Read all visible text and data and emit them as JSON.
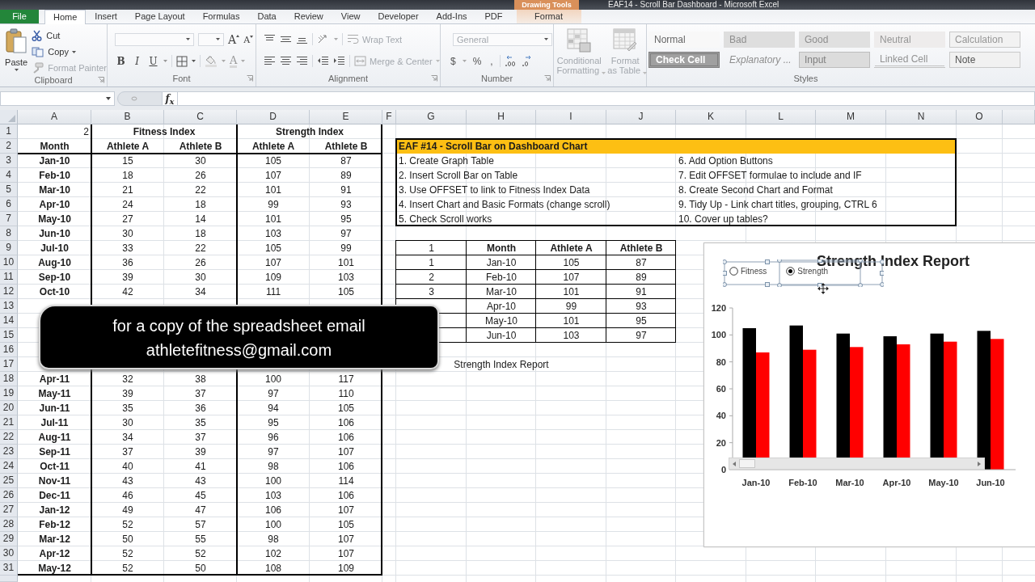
{
  "window": {
    "title": "EAF14 - Scroll Bar Dashboard - Microsoft Excel"
  },
  "contextual_group": {
    "label": "Drawing Tools"
  },
  "ribbon_tabs": [
    {
      "label": "File",
      "kind": "file",
      "selected": false
    },
    {
      "label": "Home",
      "kind": "standard",
      "selected": true
    },
    {
      "label": "Insert",
      "kind": "standard",
      "selected": false
    },
    {
      "label": "Page Layout",
      "kind": "standard",
      "selected": false
    },
    {
      "label": "Formulas",
      "kind": "standard",
      "selected": false
    },
    {
      "label": "Data",
      "kind": "standard",
      "selected": false
    },
    {
      "label": "Review",
      "kind": "standard",
      "selected": false
    },
    {
      "label": "View",
      "kind": "standard",
      "selected": false
    },
    {
      "label": "Developer",
      "kind": "standard",
      "selected": false
    },
    {
      "label": "Add-Ins",
      "kind": "standard",
      "selected": false
    },
    {
      "label": "PDF",
      "kind": "standard",
      "selected": false
    },
    {
      "label": "Format",
      "kind": "contextual",
      "selected": false
    }
  ],
  "ribbon": {
    "clipboard": {
      "label": "Clipboard",
      "paste": "Paste",
      "items": [
        {
          "kind": "cut",
          "label": "Cut",
          "dropdown": false,
          "disabled": false
        },
        {
          "kind": "copy",
          "label": "Copy",
          "dropdown": true,
          "disabled": false
        },
        {
          "kind": "painter",
          "label": "Format Painter",
          "dropdown": false,
          "disabled": true
        }
      ]
    },
    "font": {
      "label": "Font",
      "size_buttons": [
        {
          "kind": "grow",
          "glyph": "A"
        },
        {
          "kind": "shrink",
          "glyph": "A"
        }
      ],
      "style_buttons": [
        {
          "kind": "bold",
          "glyph": "B"
        },
        {
          "kind": "italic",
          "glyph": "I"
        },
        {
          "kind": "underline",
          "glyph": "U"
        }
      ],
      "font_color_glyph": "A"
    },
    "alignment": {
      "label": "Alignment",
      "wrap": {
        "label": "Wrap Text",
        "disabled": true
      },
      "merge": {
        "label": "Merge & Center",
        "disabled": true
      }
    },
    "number": {
      "label": "Number",
      "format": {
        "value": "General",
        "disabled": true
      },
      "symbols": [
        "$",
        "%",
        ","
      ]
    },
    "table_tools": [
      {
        "kind": "conditional",
        "label": "Conditional Formatting",
        "disabled": true
      },
      {
        "kind": "table",
        "label": "Format as Table",
        "disabled": true
      }
    ],
    "styles": {
      "label": "Styles",
      "items": [
        {
          "label": "Normal",
          "kind": "normal"
        },
        {
          "label": "Bad",
          "kind": "bad"
        },
        {
          "label": "Good",
          "kind": "good"
        },
        {
          "label": "Neutral",
          "kind": "neutral"
        },
        {
          "label": "Calculation",
          "kind": "calculation"
        },
        {
          "label": "Check Cell",
          "kind": "check"
        },
        {
          "label": "Explanatory ...",
          "kind": "explanatory"
        },
        {
          "label": "Input",
          "kind": "input"
        },
        {
          "label": "Linked Cell",
          "kind": "linked"
        },
        {
          "label": "Note",
          "kind": "note"
        }
      ]
    }
  },
  "formula_bar": {
    "function_label": "f$_{x}$"
  },
  "sheet": {
    "column_headers": [
      "A",
      "B",
      "C",
      "D",
      "E",
      "F",
      "G",
      "H",
      "I",
      "J",
      "K",
      "L",
      "M",
      "N",
      "O"
    ],
    "rows": [
      {
        "number": "1",
        "fitness_title": {
          "corner": "2",
          "groups": [
            "Fitness Index",
            "Strength Index"
          ]
        }
      },
      {
        "number": "2",
        "fitness_header": [
          "Month",
          "Athlete A",
          "Athlete B",
          "Athlete A",
          "Athlete B"
        ],
        "steps_title": "EAF #14 - Scroll Bar on Dashboard Chart"
      },
      {
        "number": "3",
        "fitness": [
          "Jan-10",
          "15",
          "30",
          "105",
          "87"
        ],
        "steps": [
          "1. Create Graph Table",
          "6. Add Option Buttons"
        ]
      },
      {
        "number": "4",
        "fitness": [
          "Feb-10",
          "18",
          "26",
          "107",
          "89"
        ],
        "steps": [
          "2. Insert Scroll Bar on Table",
          "7. Edit OFFSET formulae to include and IF"
        ]
      },
      {
        "number": "5",
        "fitness": [
          "Mar-10",
          "21",
          "22",
          "101",
          "91"
        ],
        "steps": [
          "3. Use OFFSET to link to Fitness Index Data",
          "8. Create Second Chart and Format"
        ]
      },
      {
        "number": "6",
        "fitness": [
          "Apr-10",
          "24",
          "18",
          "99",
          "93"
        ],
        "steps": [
          "4. Insert Chart and Basic Formats (change scroll)",
          "9. Tidy Up - Link chart titles, grouping, CTRL 6"
        ]
      },
      {
        "number": "7",
        "fitness": [
          "May-10",
          "27",
          "14",
          "101",
          "95"
        ],
        "steps": [
          "5. Check Scroll works",
          "10. Cover up tables?"
        ]
      },
      {
        "number": "8",
        "fitness": [
          "Jun-10",
          "30",
          "18",
          "103",
          "97"
        ]
      },
      {
        "number": "9",
        "fitness": [
          "Jul-10",
          "33",
          "22",
          "105",
          "99"
        ],
        "graph_header": [
          "1",
          "Month",
          "Athlete A",
          "Athlete B"
        ]
      },
      {
        "number": "10",
        "fitness": [
          "Aug-10",
          "36",
          "26",
          "107",
          "101"
        ],
        "graph": [
          "1",
          "Jan-10",
          "105",
          "87"
        ]
      },
      {
        "number": "11",
        "fitness": [
          "Sep-10",
          "39",
          "30",
          "109",
          "103"
        ],
        "graph": [
          "2",
          "Feb-10",
          "107",
          "89"
        ]
      },
      {
        "number": "12",
        "fitness": [
          "Oct-10",
          "42",
          "34",
          "111",
          "105"
        ],
        "graph": [
          "3",
          "Mar-10",
          "101",
          "91"
        ]
      },
      {
        "number": "13",
        "graph": [
          "Apr-10",
          "99",
          "93"
        ]
      },
      {
        "number": "14",
        "graph": [
          "May-10",
          "101",
          "95"
        ]
      },
      {
        "number": "15",
        "graph": [
          "Jun-10",
          "103",
          "97"
        ]
      },
      {
        "number": "16"
      },
      {
        "number": "17",
        "caption": "Strength Index Report"
      },
      {
        "number": "18",
        "fitness": [
          "Apr-11",
          "32",
          "38",
          "100",
          "117"
        ]
      },
      {
        "number": "19",
        "fitness": [
          "May-11",
          "39",
          "37",
          "97",
          "110"
        ]
      },
      {
        "number": "20",
        "fitness": [
          "Jun-11",
          "35",
          "36",
          "94",
          "105"
        ]
      },
      {
        "number": "21",
        "fitness": [
          "Jul-11",
          "30",
          "35",
          "95",
          "106"
        ]
      },
      {
        "number": "22",
        "fitness": [
          "Aug-11",
          "34",
          "37",
          "96",
          "106"
        ]
      },
      {
        "number": "23",
        "fitness": [
          "Sep-11",
          "37",
          "39",
          "97",
          "107"
        ]
      },
      {
        "number": "24",
        "fitness": [
          "Oct-11",
          "40",
          "41",
          "98",
          "106"
        ]
      },
      {
        "number": "25",
        "fitness": [
          "Nov-11",
          "43",
          "43",
          "100",
          "114"
        ]
      },
      {
        "number": "26",
        "fitness": [
          "Dec-11",
          "46",
          "45",
          "103",
          "106"
        ]
      },
      {
        "number": "27",
        "fitness": [
          "Jan-12",
          "49",
          "47",
          "106",
          "107"
        ]
      },
      {
        "number": "28",
        "fitness": [
          "Feb-12",
          "52",
          "57",
          "100",
          "105"
        ]
      },
      {
        "number": "29",
        "fitness": [
          "Mar-12",
          "50",
          "55",
          "98",
          "107"
        ]
      },
      {
        "number": "30",
        "fitness": [
          "Apr-12",
          "52",
          "52",
          "102",
          "107"
        ]
      },
      {
        "number": "31",
        "fitness": [
          "May-12",
          "52",
          "50",
          "108",
          "109"
        ]
      }
    ]
  },
  "banner": {
    "lines": [
      "for a copy of the spreadsheet email",
      "athletefitness@gmail.com"
    ]
  },
  "chart": {
    "options": [
      {
        "label": "Fitness",
        "selected": false
      },
      {
        "label": "Strength",
        "selected": true
      }
    ],
    "chart_data": {
      "type": "bar",
      "title": "Strength Index Report",
      "categories": [
        "Jan-10",
        "Feb-10",
        "Mar-10",
        "Apr-10",
        "May-10",
        "Jun-10"
      ],
      "series": [
        {
          "color": "#000000",
          "values": [
            105,
            107,
            101,
            99,
            101,
            103
          ]
        },
        {
          "color": "#ff0000",
          "values": [
            87,
            89,
            91,
            93,
            95,
            97
          ]
        }
      ],
      "ylim": [
        0,
        120
      ],
      "yticks": [
        0,
        20,
        40,
        60,
        80,
        100,
        120
      ]
    }
  }
}
